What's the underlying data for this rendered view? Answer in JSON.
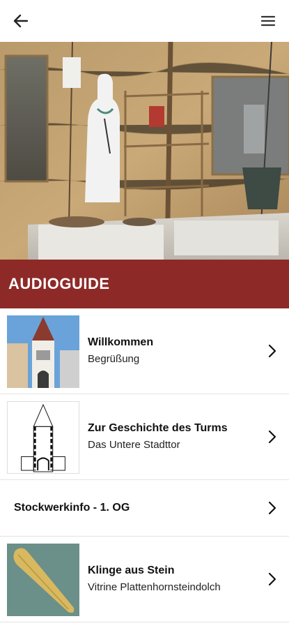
{
  "header": {
    "back_icon": "arrow-left-icon",
    "menu_icon": "hamburger-menu-icon"
  },
  "hero": {
    "image": "museum-exhibit-display-photo"
  },
  "section": {
    "title": "AUDIOGUIDE",
    "color": "#8d2a28"
  },
  "items": [
    {
      "title": "Willkommen",
      "subtitle": "Begrüßung",
      "thumb": "tower-photo"
    },
    {
      "title": "Zur Geschichte des Turms",
      "subtitle": "Das Untere Stadttor",
      "thumb": "tower-drawing"
    },
    {
      "title": "Stockwerkinfo - 1. OG"
    },
    {
      "title": "Klinge aus Stein",
      "subtitle": "Vitrine Plattenhornsteindolch",
      "thumb": "stone-blade-photo"
    }
  ]
}
